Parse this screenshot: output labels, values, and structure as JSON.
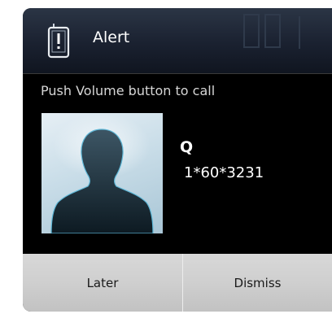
{
  "dialog": {
    "title": "Alert",
    "title_icon": "phone-alert-icon",
    "message": "Push Volume button to call"
  },
  "contact": {
    "name": "Q",
    "number": "1*60*3231",
    "avatar_icon": "person-silhouette-icon"
  },
  "buttons": {
    "later_label": "Later",
    "dismiss_label": "Dismiss"
  },
  "colors": {
    "dialog_background": "#000000",
    "header_gradient_top": "#2b3545",
    "button_bar": "#cfcfcf",
    "text_primary": "#ffffff"
  }
}
